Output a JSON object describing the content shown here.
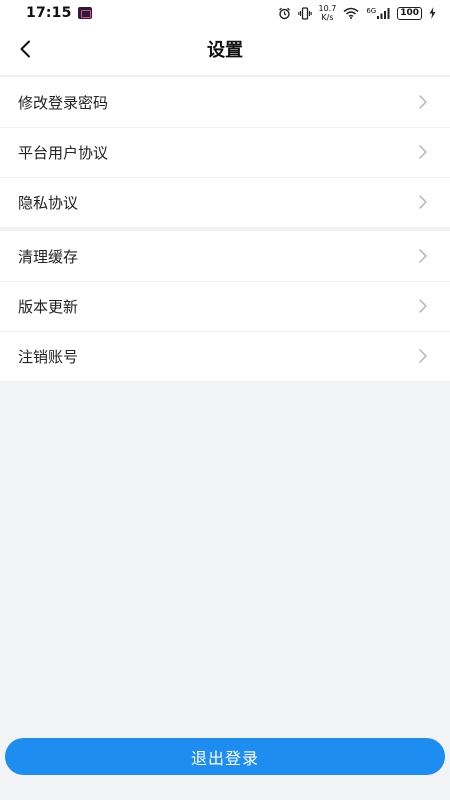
{
  "status_bar": {
    "time": "17:15",
    "net_speed_value": "10.7",
    "net_speed_unit": "K/s",
    "signal_label": "6G",
    "battery": "100"
  },
  "header": {
    "back_icon": "chevron-left-icon",
    "title": "设置"
  },
  "settings_groups": [
    {
      "items": [
        {
          "label": "修改登录密码"
        },
        {
          "label": "平台用户协议"
        },
        {
          "label": "隐私协议"
        }
      ]
    },
    {
      "items": [
        {
          "label": "清理缓存"
        },
        {
          "label": "版本更新"
        },
        {
          "label": "注销账号"
        }
      ]
    }
  ],
  "logout_label": "退出登录",
  "colors": {
    "accent": "#1e8df2",
    "page_bg": "#f2f3f5",
    "card_bg": "#ffffff",
    "chevron": "#b5b5b5"
  }
}
